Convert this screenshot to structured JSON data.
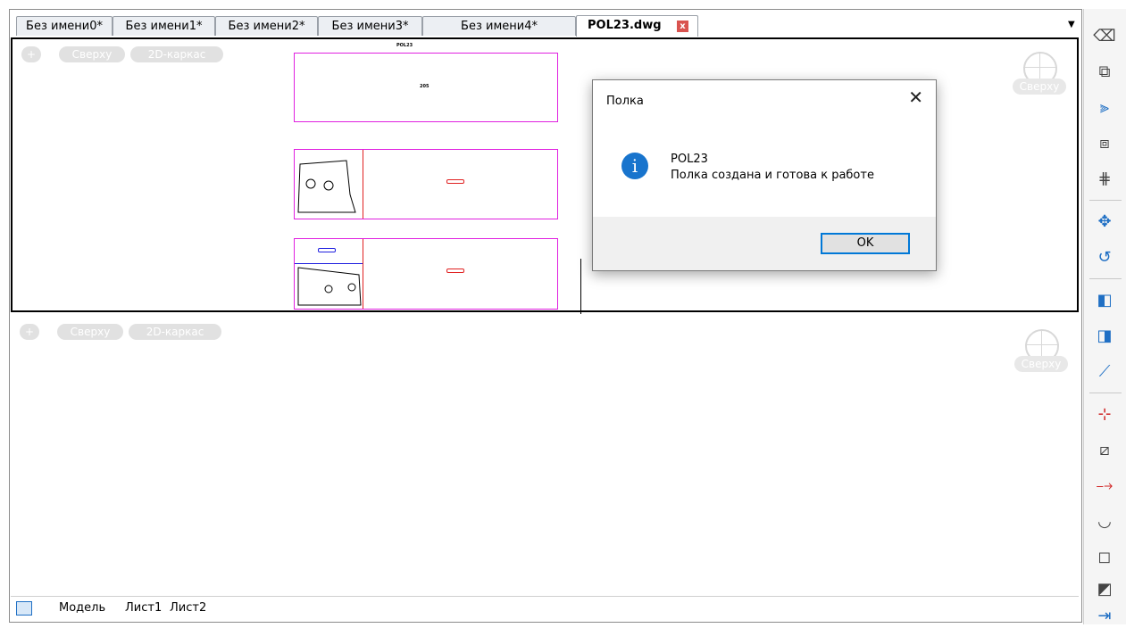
{
  "tabs": [
    {
      "label": "Без имени0*"
    },
    {
      "label": "Без имени1*"
    },
    {
      "label": "Без имени2*"
    },
    {
      "label": "Без имени3*"
    },
    {
      "label": "Без имени4*"
    },
    {
      "label": "POL23.dwg",
      "active": true
    }
  ],
  "tab_close_glyph": "x",
  "tab_menu_glyph": "▼",
  "viewports": [
    {
      "controls": [
        "+",
        "Сверху",
        "2D-каркас"
      ],
      "navcube_label": "Сверху"
    },
    {
      "controls": [
        "+",
        "Сверху",
        "2D-каркас"
      ],
      "navcube_label": "Сверху"
    }
  ],
  "drawing": {
    "sheet_label_1": "POL23",
    "center_label": "205"
  },
  "dialog": {
    "title": "Полка",
    "icon": "info-icon",
    "line1": "POL23",
    "line2": "Полка создана и готова к работе",
    "ok_label": "OK",
    "close_glyph": "✕"
  },
  "layout_tabs": [
    "Модель",
    "Лист1",
    "Лист2"
  ],
  "toolbar": {
    "tools": [
      "erase-icon",
      "copy-icon",
      "mirror-icon",
      "offset-icon",
      "array-icon",
      "move-icon",
      "rotate-icon",
      "scale-icon",
      "stretch-icon",
      "lengthen-icon",
      "trim-icon",
      "break-icon",
      "extend-icon",
      "join-icon",
      "chamfer-icon",
      "fillet-icon",
      "explode-icon"
    ]
  },
  "colors": {
    "accent": "#0078d7",
    "info": "#1874cd",
    "sheet_border": "#e020e0",
    "red": "#e02020",
    "blue": "#2020e0"
  }
}
